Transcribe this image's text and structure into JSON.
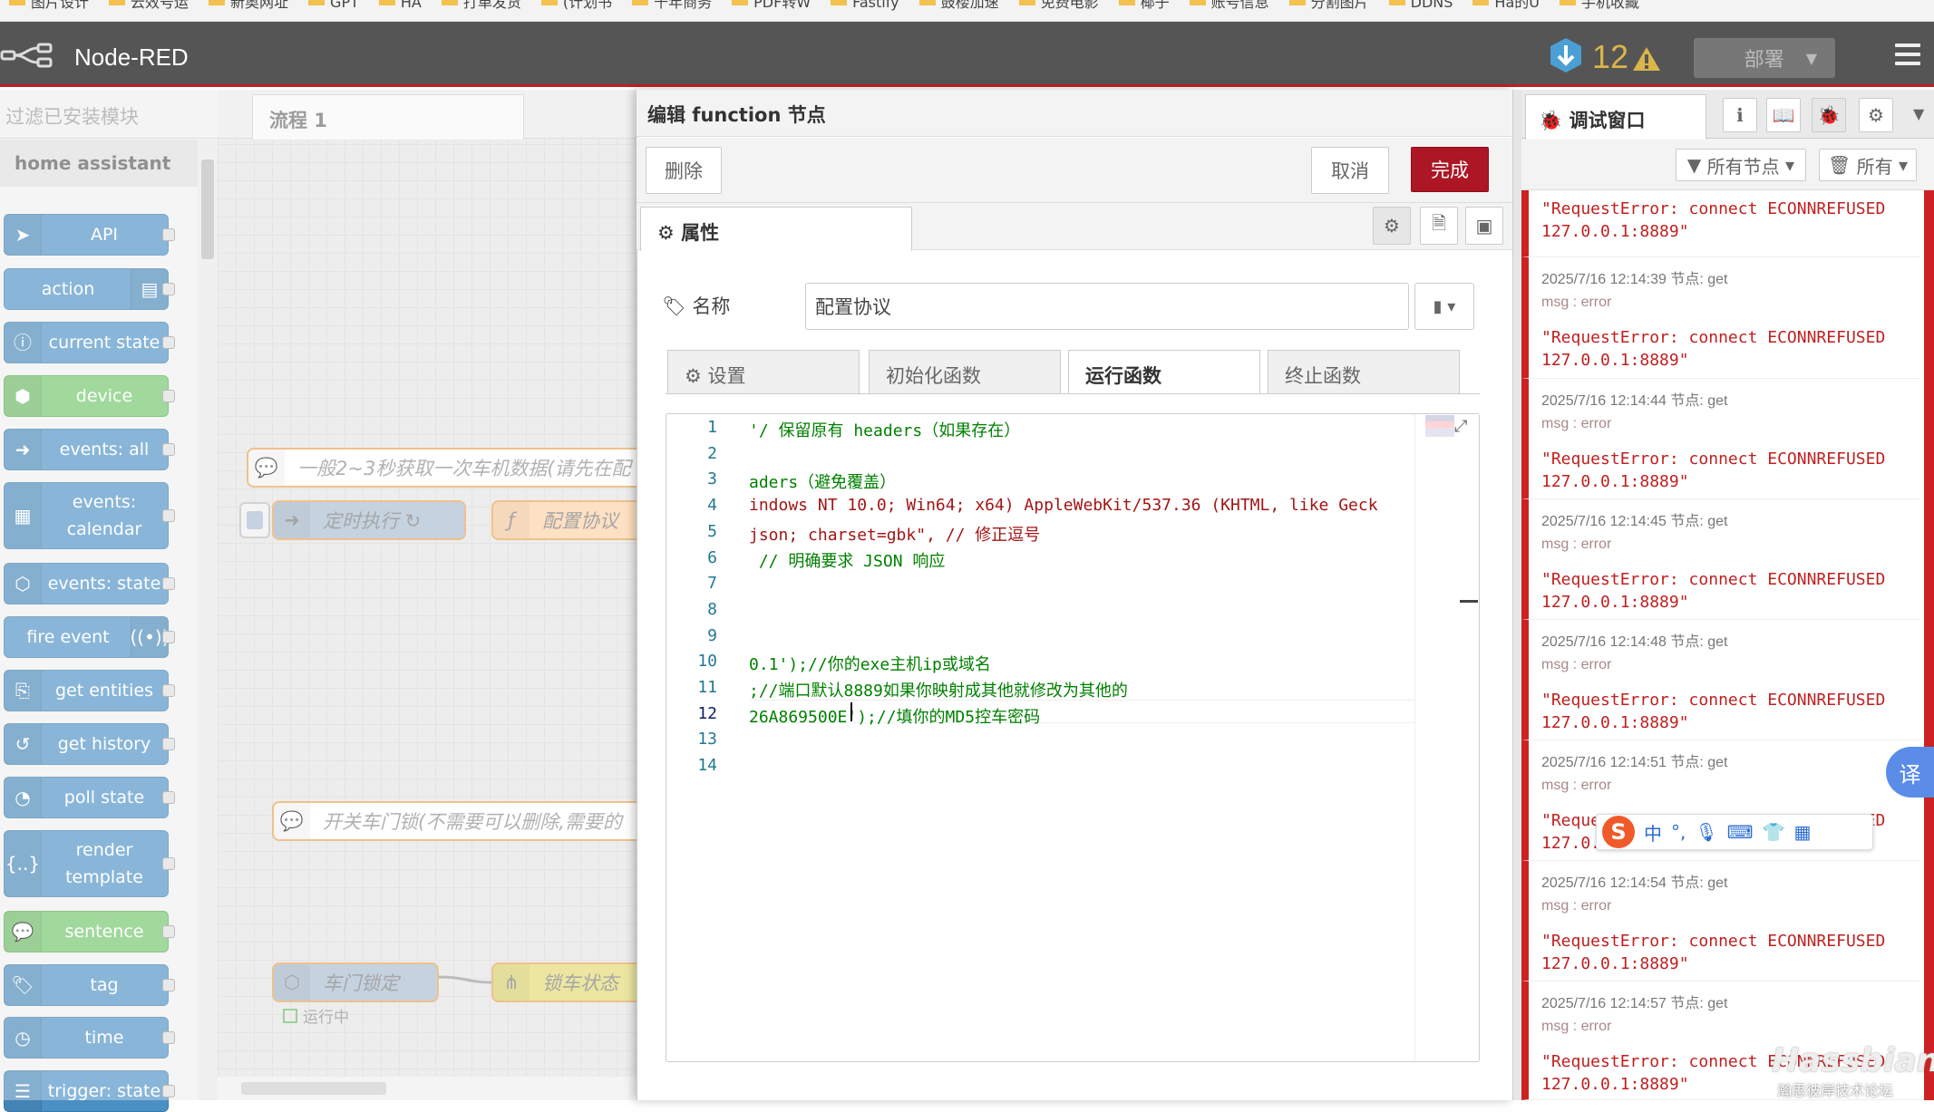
{
  "bookmarks": [
    "图片设计",
    "云效号运",
    "新奥网址",
    "GPT",
    "HA",
    "打单发货",
    "(计划书",
    "千年商务",
    "PDF转W",
    "Fastify",
    "鼓楼加速",
    "免费电影",
    "椰子",
    "账号信息",
    "分割图片",
    "DDNS",
    "Ha的U",
    "手机收藏"
  ],
  "header": {
    "title": "Node-RED",
    "warn_count": "12",
    "deploy_label": "部署"
  },
  "palette": {
    "filter_placeholder": "过滤已安装模块",
    "category": "home assistant",
    "nodes": [
      {
        "label": "API",
        "icon": "send-icon"
      },
      {
        "label": "action",
        "icon": "router-icon"
      },
      {
        "label": "current state",
        "icon": "info-icon"
      },
      {
        "label": "device",
        "icon": "cube-icon"
      },
      {
        "label": "events: all",
        "icon": "arrow-icon"
      },
      {
        "label": "events: calendar",
        "icon": "calendar-icon"
      },
      {
        "label": "events: state",
        "icon": "state-icon"
      },
      {
        "label": "fire event",
        "icon": "broadcast-icon"
      },
      {
        "label": "get entities",
        "icon": "entities-icon"
      },
      {
        "label": "get history",
        "icon": "history-icon"
      },
      {
        "label": "poll state",
        "icon": "timer-icon"
      },
      {
        "label": "render template",
        "icon": "braces-icon"
      },
      {
        "label": "sentence",
        "icon": "speech-icon"
      },
      {
        "label": "tag",
        "icon": "tag-icon"
      },
      {
        "label": "time",
        "icon": "clock-icon"
      },
      {
        "label": "trigger: state",
        "icon": "sliders-icon"
      }
    ]
  },
  "workspace": {
    "tab_label": "流程 1",
    "comment1": "一般2~3秒获取一次车机数据(请先在配",
    "inject1": "定时执行 ↻",
    "func1": "配置协议",
    "comment2": "开关车门锁(不需要可以删除,需要的",
    "node_lock": "车门锁定",
    "node_status": "锁车状态",
    "running": "运行中"
  },
  "tray": {
    "title": "编辑 function 节点",
    "delete_label": "删除",
    "cancel_label": "取消",
    "done_label": "完成",
    "props_tab": "属性",
    "name_label": "名称",
    "name_value": "配置协议",
    "subtabs": [
      "设置",
      "初始化函数",
      "运行函数",
      "终止函数"
    ],
    "code_lines": [
      {
        "n": "1",
        "code": "'/ 保留原有 headers（如果存在）",
        "cls": "cm"
      },
      {
        "n": "2",
        "code": "",
        "cls": "tx"
      },
      {
        "n": "3",
        "code": "aders（避免覆盖）",
        "cls": "cm"
      },
      {
        "n": "4",
        "code": "indows NT 10.0; Win64; x64) AppleWebKit/537.36 (KHTML, like Geck",
        "cls": "str"
      },
      {
        "n": "5",
        "code": "json; charset=gbk\", // 修正逗号",
        "cls": "str"
      },
      {
        "n": "6",
        "code": " // 明确要求 JSON 响应",
        "cls": "cm"
      },
      {
        "n": "7",
        "code": "",
        "cls": "tx"
      },
      {
        "n": "8",
        "code": "",
        "cls": "tx"
      },
      {
        "n": "9",
        "code": "",
        "cls": "tx"
      },
      {
        "n": "10",
        "code": "0.1');//你的exe主机ip或域名",
        "cls": "mix"
      },
      {
        "n": "11",
        "code": ";//端口默认8889如果你映射成其他就修改为其他的",
        "cls": "mix"
      },
      {
        "n": "12",
        "code": "26A869500E');//填你的MD5控车密码",
        "cls": "mix"
      },
      {
        "n": "13",
        "code": "",
        "cls": "tx"
      },
      {
        "n": "14",
        "code": "",
        "cls": "tx"
      }
    ]
  },
  "sidebar": {
    "tab_label": "调试窗口",
    "filter_nodes": "所有节点",
    "clear_label": "所有",
    "messages": [
      {
        "meta": "",
        "topic": "",
        "value": "\"RequestError: connect ECONNREFUSED\n127.0.0.1:8889\""
      },
      {
        "meta": "2025/7/16 12:14:39   节点: get",
        "topic": "msg : error",
        "value": "\"RequestError: connect ECONNREFUSED\n127.0.0.1:8889\""
      },
      {
        "meta": "2025/7/16 12:14:44   节点: get",
        "topic": "msg : error",
        "value": "\"RequestError: connect ECONNREFUSED\n127.0.0.1:8889\""
      },
      {
        "meta": "2025/7/16 12:14:45   节点: get",
        "topic": "msg : error",
        "value": "\"RequestError: connect ECONNREFUSED\n127.0.0.1:8889\""
      },
      {
        "meta": "2025/7/16 12:14:48   节点: get",
        "topic": "msg : error",
        "value": "\"RequestError: connect ECONNREFUSED\n127.0.0.1:8889\""
      },
      {
        "meta": "2025/7/16 12:14:51   节点: get",
        "topic": "msg : error",
        "value": "\"RequestError: connect ECONNREFUSED\n127.0.0.1:8889\""
      },
      {
        "meta": "2025/7/16 12:14:54   节点: get",
        "topic": "msg : error",
        "value": "\"RequestError: connect ECONNREFUSED\n127.0.0.1:8889\""
      },
      {
        "meta": "2025/7/16 12:14:57   节点: get",
        "topic": "msg : error",
        "value": "\"RequestError: connect ECONNREFUSED\n127.0.0.1:8889\""
      }
    ]
  },
  "ime": {
    "logo": "S",
    "mode": "中",
    "punct": "°,"
  },
  "translate": "译",
  "watermark": {
    "main": "Hassbian",
    "sub": "瀚思彼岸技术论坛"
  }
}
